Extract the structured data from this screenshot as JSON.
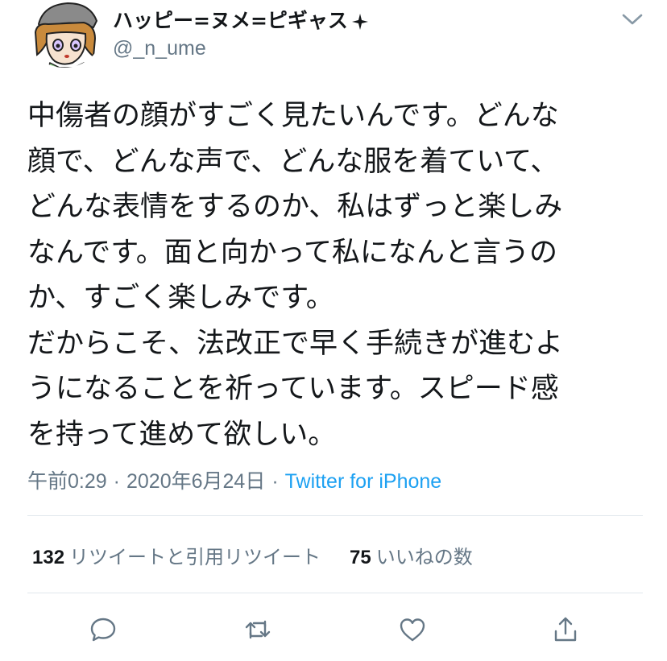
{
  "tweet": {
    "display_name": "ハッピー=ヌメ=ピギャス",
    "username": "@_n_ume",
    "text": "中傷者の顔がすごく見たいんです。どんな\n顔で、どんな声で、どんな服を着ていて、\nどんな表情をするのか、私はずっと楽しみ\nなんです。面と向かって私になんと言うの\nか、すごく楽しみです。\nだからこそ、法改正で早く手続きが進むよ\nうになることを祈っています。スピード感\nを持って進めて欲しい。",
    "time": "午前0:29",
    "separator": "·",
    "date": "2020年6月24日",
    "source": "Twitter for iPhone"
  },
  "stats": {
    "retweets_count": "132",
    "retweets_label": "リツイートと引用リツイート",
    "likes_count": "75",
    "likes_label": "いいねの数"
  },
  "icons": {
    "more": "chevron-down-icon",
    "reply": "reply-icon",
    "retweet": "retweet-icon",
    "like": "heart-icon",
    "share": "share-icon"
  },
  "colors": {
    "text": "#14171a",
    "secondary": "#657786",
    "link": "#1da1f2",
    "divider": "#e1e8ed"
  }
}
